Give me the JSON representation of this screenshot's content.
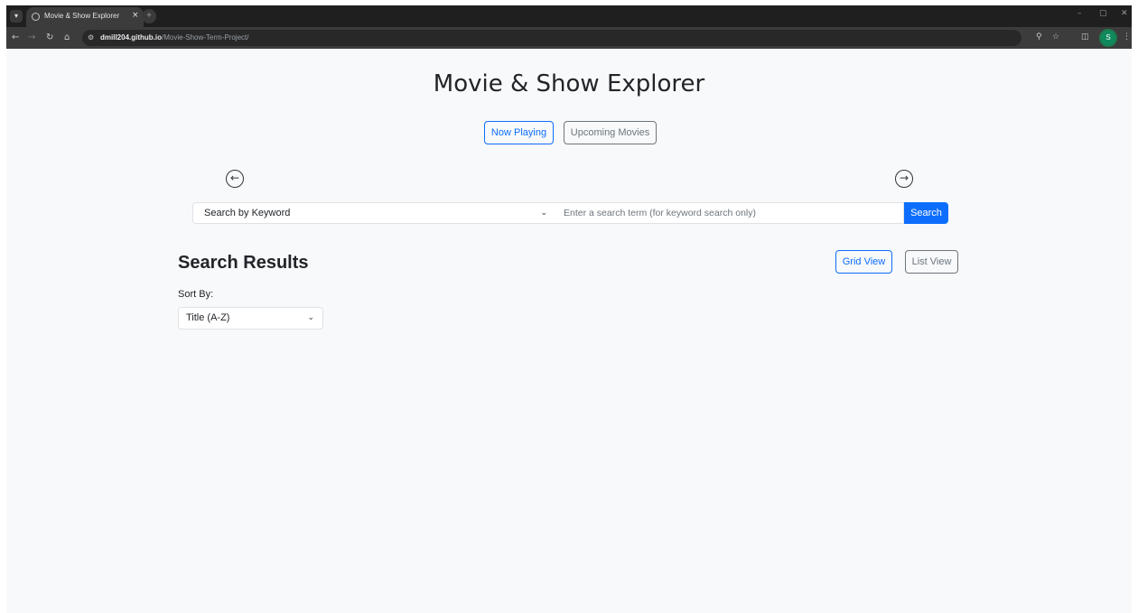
{
  "browser": {
    "tab_title": "Movie & Show Explorer",
    "tab_close_glyph": "×",
    "new_tab_glyph": "+",
    "url_host": "dmill204.github.io",
    "url_path": "/Movie-Show-Term-Project/",
    "profile_initial": "S",
    "window_controls": [
      "–",
      "▢",
      "✕"
    ]
  },
  "header": {
    "title": "Movie & Show Explorer",
    "tabs": [
      {
        "label": "Now Playing",
        "active": true
      },
      {
        "label": "Upcoming Movies",
        "active": false
      }
    ]
  },
  "carousel": {
    "prev_icon": "arrow-left-circle-icon",
    "next_icon": "arrow-right-circle-icon"
  },
  "search": {
    "mode_selected": "Search by Keyword",
    "placeholder": "Enter a search term (for keyword search only)",
    "button_label": "Search"
  },
  "results": {
    "title": "Search Results",
    "grid_view_label": "Grid View",
    "list_view_label": "List View",
    "sort_label": "Sort By:",
    "sort_selected": "Title (A-Z)"
  },
  "colors": {
    "primary": "#0d6efd",
    "secondary": "#6c757d",
    "page_bg": "#f8f9fa",
    "chrome_dark": "#1f1f1f",
    "profile": "#0f8a5f"
  }
}
